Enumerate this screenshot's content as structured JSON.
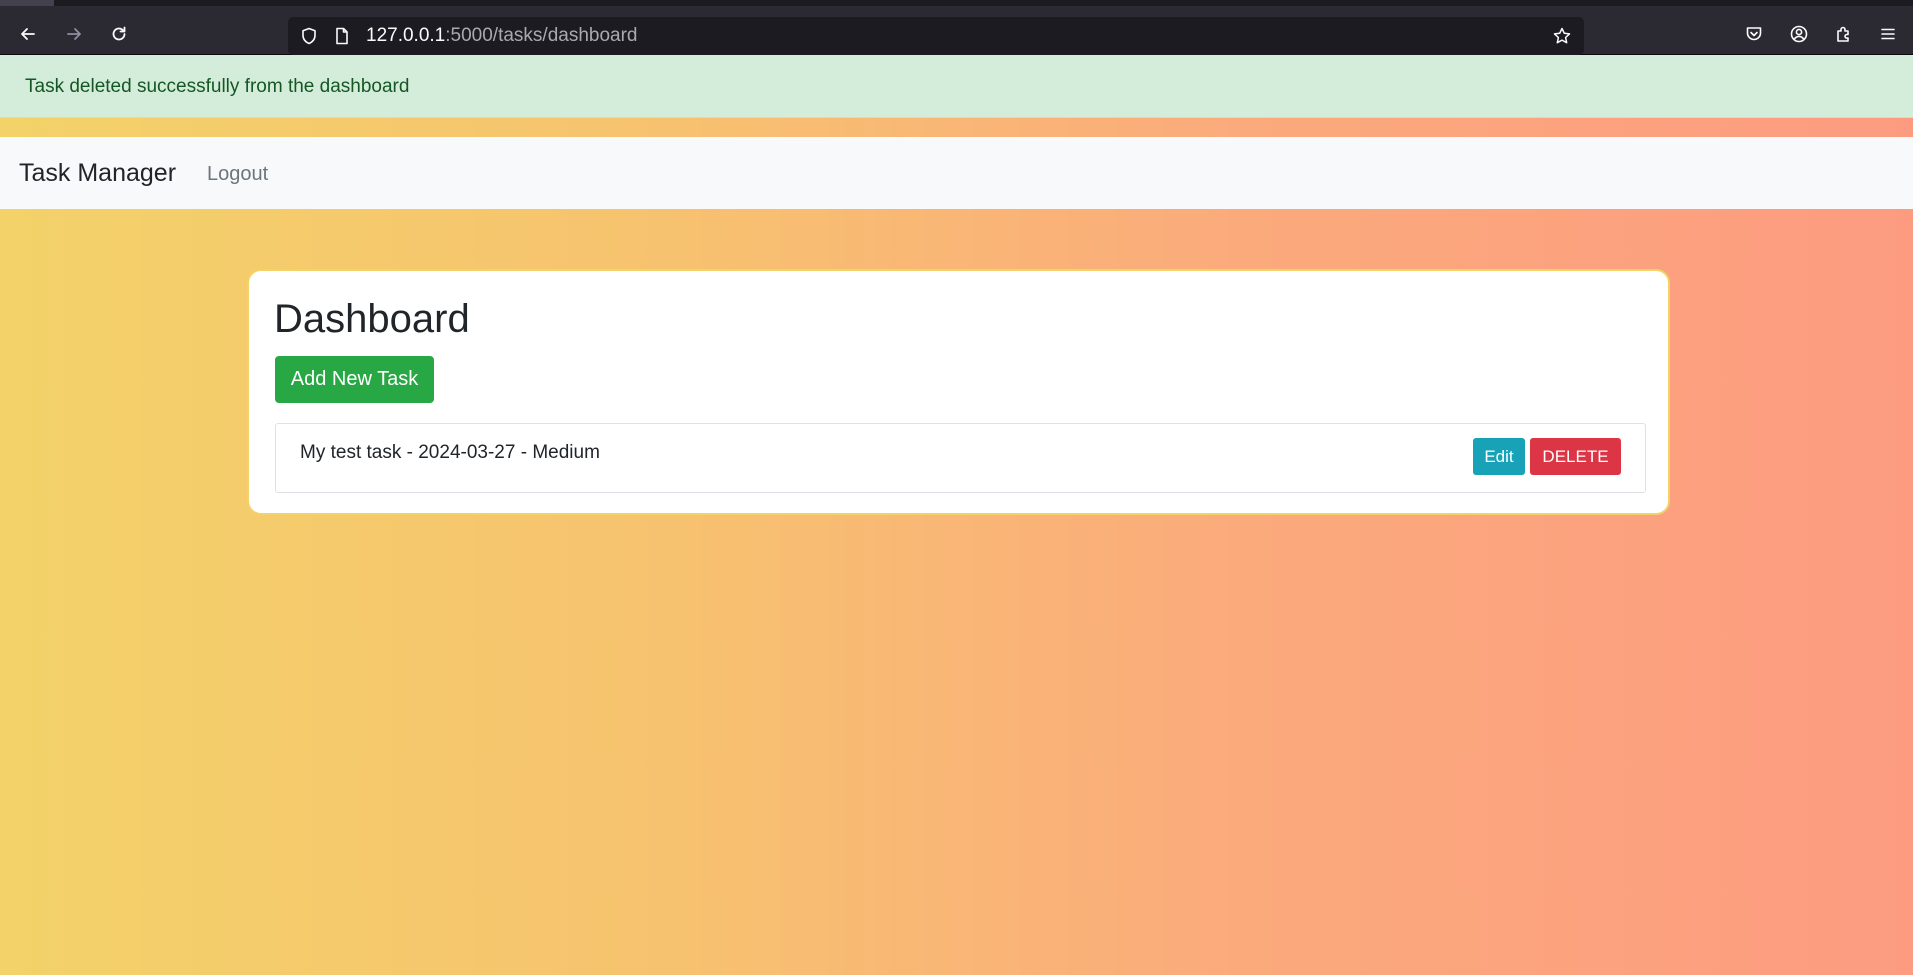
{
  "browser": {
    "url_host": "127.0.0.1",
    "url_path": ":5000/tasks/dashboard",
    "icons": {
      "back": "back-arrow-icon",
      "forward": "forward-arrow-icon",
      "reload": "reload-icon",
      "tracking": "shield-icon",
      "page": "page-icon",
      "bookmark": "star-icon",
      "pocket": "pocket-icon",
      "account": "account-icon",
      "extensions": "extensions-icon",
      "menu": "hamburger-menu-icon"
    }
  },
  "flash": {
    "message": "Task deleted successfully from the dashboard"
  },
  "navbar": {
    "brand": "Task Manager",
    "logout": "Logout"
  },
  "dashboard": {
    "title": "Dashboard",
    "add_button": "Add New Task",
    "tasks": [
      {
        "text": "My test task - 2024-03-27 - Medium",
        "edit_label": "Edit",
        "delete_label": "DELETE"
      }
    ]
  },
  "colors": {
    "flash_bg": "#d4edda",
    "flash_text": "#155724",
    "add_button": "#28a745",
    "edit_button": "#17a2b8",
    "delete_button": "#dc3545",
    "gradient_start": "#f3d269",
    "gradient_end": "#fc9b80"
  }
}
